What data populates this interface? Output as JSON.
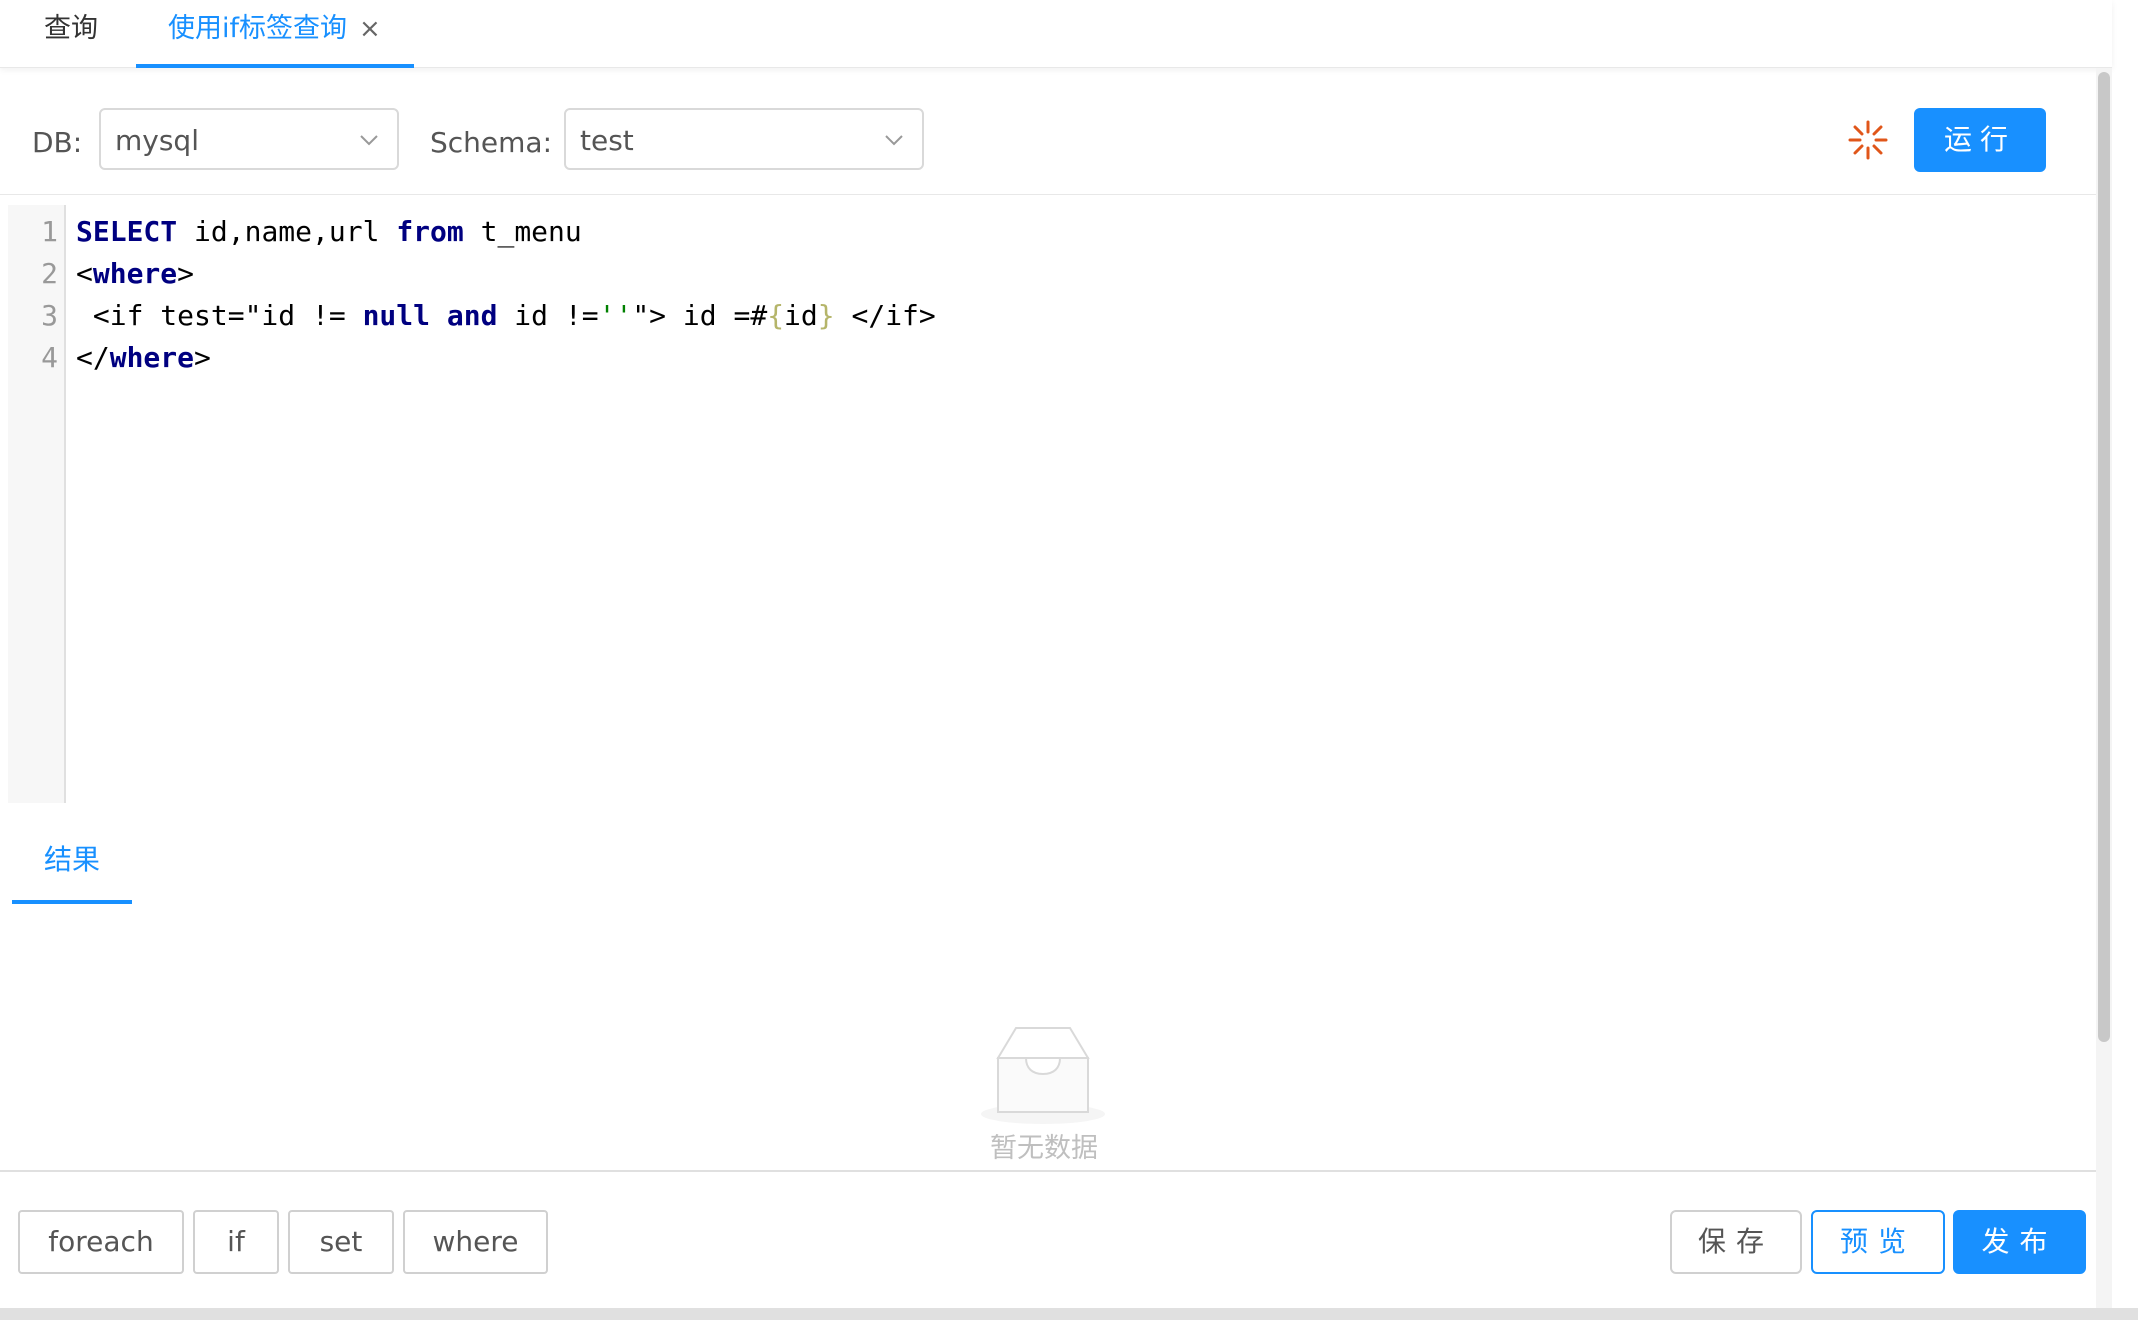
{
  "tabs": [
    {
      "label": "查询"
    },
    {
      "label": "使用if标签查询",
      "close": "×"
    }
  ],
  "toolbar": {
    "db_label": "DB:",
    "db_value": "mysql",
    "schema_label": "Schema:",
    "schema_value": "test",
    "run_label": "运行"
  },
  "editor": {
    "line_numbers": [
      "1",
      "2",
      "3",
      "4"
    ],
    "lines": [
      [
        {
          "t": "SELECT",
          "c": "kw"
        },
        {
          "t": " id,name,url ",
          "c": ""
        },
        {
          "t": "from",
          "c": "kw"
        },
        {
          "t": " t_menu",
          "c": ""
        }
      ],
      [
        {
          "t": "<",
          "c": ""
        },
        {
          "t": "where",
          "c": "kw"
        },
        {
          "t": ">",
          "c": ""
        }
      ],
      [
        {
          "t": " <if test=\"id != ",
          "c": ""
        },
        {
          "t": "null",
          "c": "kw"
        },
        {
          "t": " ",
          "c": ""
        },
        {
          "t": "and",
          "c": "kw"
        },
        {
          "t": " id !=",
          "c": ""
        },
        {
          "t": "''",
          "c": "str"
        },
        {
          "t": "\"> id =#",
          "c": ""
        },
        {
          "t": "{",
          "c": "brace"
        },
        {
          "t": "id",
          "c": ""
        },
        {
          "t": "}",
          "c": "brace"
        },
        {
          "t": " </if>",
          "c": ""
        }
      ],
      [
        {
          "t": "</",
          "c": ""
        },
        {
          "t": "where",
          "c": "kw"
        },
        {
          "t": ">",
          "c": ""
        }
      ]
    ]
  },
  "results": {
    "tab_label": "结果",
    "empty_text": "暂无数据"
  },
  "bottom": {
    "tags": [
      "foreach",
      "if",
      "set",
      "where"
    ],
    "save_label": "保存",
    "preview_label": "预览",
    "publish_label": "发布"
  },
  "colors": {
    "accent": "#1890ff",
    "keyword": "#000080",
    "string": "#008000",
    "spinner": "#e0561a"
  }
}
